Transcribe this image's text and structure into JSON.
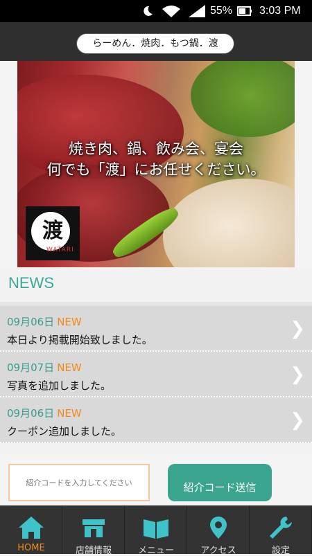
{
  "status_bar": {
    "battery_percent": "55%",
    "time": "3:03 PM"
  },
  "app_title": "らーめん．焼肉．もつ鍋．渡",
  "hero": {
    "line1": "焼き肉、鍋、飲み会、宴会",
    "line2": "何でも「渡」にお任せください。",
    "logo_kanji": "渡",
    "logo_sub": "WATARI"
  },
  "news": {
    "title": "NEWS",
    "items": [
      {
        "date": "09月06日",
        "badge": "NEW",
        "text": "本日より掲載開始致しました。"
      },
      {
        "date": "09月07日",
        "badge": "NEW",
        "text": "写真を追加しました。"
      },
      {
        "date": "09月06日",
        "badge": "NEW",
        "text": "クーポン追加しました。"
      }
    ]
  },
  "referral": {
    "placeholder": "紹介コードを入力してください",
    "button": "紹介コード送信"
  },
  "tabs": [
    {
      "label": "HOME",
      "icon": "home-icon"
    },
    {
      "label": "店舗情報",
      "icon": "store-icon"
    },
    {
      "label": "メニュー",
      "icon": "book-icon"
    },
    {
      "label": "アクセス",
      "icon": "map-pin-icon"
    },
    {
      "label": "設定",
      "icon": "wrench-icon"
    }
  ],
  "colors": {
    "accent": "#3aa89a",
    "new_badge": "#f08a1c",
    "tab_active": "#f08a1c"
  }
}
